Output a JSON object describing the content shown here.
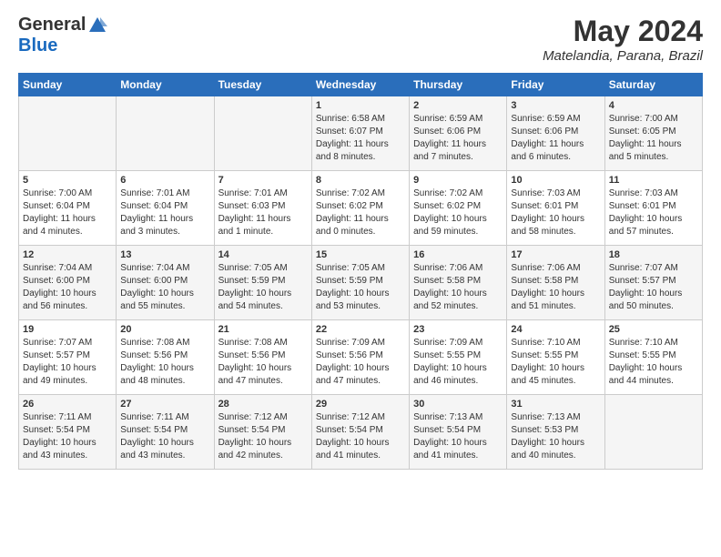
{
  "header": {
    "logo_general": "General",
    "logo_blue": "Blue",
    "month_year": "May 2024",
    "location": "Matelandia, Parana, Brazil"
  },
  "days_of_week": [
    "Sunday",
    "Monday",
    "Tuesday",
    "Wednesday",
    "Thursday",
    "Friday",
    "Saturday"
  ],
  "weeks": [
    [
      {
        "day": "",
        "info": ""
      },
      {
        "day": "",
        "info": ""
      },
      {
        "day": "",
        "info": ""
      },
      {
        "day": "1",
        "info": "Sunrise: 6:58 AM\nSunset: 6:07 PM\nDaylight: 11 hours\nand 8 minutes."
      },
      {
        "day": "2",
        "info": "Sunrise: 6:59 AM\nSunset: 6:06 PM\nDaylight: 11 hours\nand 7 minutes."
      },
      {
        "day": "3",
        "info": "Sunrise: 6:59 AM\nSunset: 6:06 PM\nDaylight: 11 hours\nand 6 minutes."
      },
      {
        "day": "4",
        "info": "Sunrise: 7:00 AM\nSunset: 6:05 PM\nDaylight: 11 hours\nand 5 minutes."
      }
    ],
    [
      {
        "day": "5",
        "info": "Sunrise: 7:00 AM\nSunset: 6:04 PM\nDaylight: 11 hours\nand 4 minutes."
      },
      {
        "day": "6",
        "info": "Sunrise: 7:01 AM\nSunset: 6:04 PM\nDaylight: 11 hours\nand 3 minutes."
      },
      {
        "day": "7",
        "info": "Sunrise: 7:01 AM\nSunset: 6:03 PM\nDaylight: 11 hours\nand 1 minute."
      },
      {
        "day": "8",
        "info": "Sunrise: 7:02 AM\nSunset: 6:02 PM\nDaylight: 11 hours\nand 0 minutes."
      },
      {
        "day": "9",
        "info": "Sunrise: 7:02 AM\nSunset: 6:02 PM\nDaylight: 10 hours\nand 59 minutes."
      },
      {
        "day": "10",
        "info": "Sunrise: 7:03 AM\nSunset: 6:01 PM\nDaylight: 10 hours\nand 58 minutes."
      },
      {
        "day": "11",
        "info": "Sunrise: 7:03 AM\nSunset: 6:01 PM\nDaylight: 10 hours\nand 57 minutes."
      }
    ],
    [
      {
        "day": "12",
        "info": "Sunrise: 7:04 AM\nSunset: 6:00 PM\nDaylight: 10 hours\nand 56 minutes."
      },
      {
        "day": "13",
        "info": "Sunrise: 7:04 AM\nSunset: 6:00 PM\nDaylight: 10 hours\nand 55 minutes."
      },
      {
        "day": "14",
        "info": "Sunrise: 7:05 AM\nSunset: 5:59 PM\nDaylight: 10 hours\nand 54 minutes."
      },
      {
        "day": "15",
        "info": "Sunrise: 7:05 AM\nSunset: 5:59 PM\nDaylight: 10 hours\nand 53 minutes."
      },
      {
        "day": "16",
        "info": "Sunrise: 7:06 AM\nSunset: 5:58 PM\nDaylight: 10 hours\nand 52 minutes."
      },
      {
        "day": "17",
        "info": "Sunrise: 7:06 AM\nSunset: 5:58 PM\nDaylight: 10 hours\nand 51 minutes."
      },
      {
        "day": "18",
        "info": "Sunrise: 7:07 AM\nSunset: 5:57 PM\nDaylight: 10 hours\nand 50 minutes."
      }
    ],
    [
      {
        "day": "19",
        "info": "Sunrise: 7:07 AM\nSunset: 5:57 PM\nDaylight: 10 hours\nand 49 minutes."
      },
      {
        "day": "20",
        "info": "Sunrise: 7:08 AM\nSunset: 5:56 PM\nDaylight: 10 hours\nand 48 minutes."
      },
      {
        "day": "21",
        "info": "Sunrise: 7:08 AM\nSunset: 5:56 PM\nDaylight: 10 hours\nand 47 minutes."
      },
      {
        "day": "22",
        "info": "Sunrise: 7:09 AM\nSunset: 5:56 PM\nDaylight: 10 hours\nand 47 minutes."
      },
      {
        "day": "23",
        "info": "Sunrise: 7:09 AM\nSunset: 5:55 PM\nDaylight: 10 hours\nand 46 minutes."
      },
      {
        "day": "24",
        "info": "Sunrise: 7:10 AM\nSunset: 5:55 PM\nDaylight: 10 hours\nand 45 minutes."
      },
      {
        "day": "25",
        "info": "Sunrise: 7:10 AM\nSunset: 5:55 PM\nDaylight: 10 hours\nand 44 minutes."
      }
    ],
    [
      {
        "day": "26",
        "info": "Sunrise: 7:11 AM\nSunset: 5:54 PM\nDaylight: 10 hours\nand 43 minutes."
      },
      {
        "day": "27",
        "info": "Sunrise: 7:11 AM\nSunset: 5:54 PM\nDaylight: 10 hours\nand 43 minutes."
      },
      {
        "day": "28",
        "info": "Sunrise: 7:12 AM\nSunset: 5:54 PM\nDaylight: 10 hours\nand 42 minutes."
      },
      {
        "day": "29",
        "info": "Sunrise: 7:12 AM\nSunset: 5:54 PM\nDaylight: 10 hours\nand 41 minutes."
      },
      {
        "day": "30",
        "info": "Sunrise: 7:13 AM\nSunset: 5:54 PM\nDaylight: 10 hours\nand 41 minutes."
      },
      {
        "day": "31",
        "info": "Sunrise: 7:13 AM\nSunset: 5:53 PM\nDaylight: 10 hours\nand 40 minutes."
      },
      {
        "day": "",
        "info": ""
      }
    ]
  ]
}
